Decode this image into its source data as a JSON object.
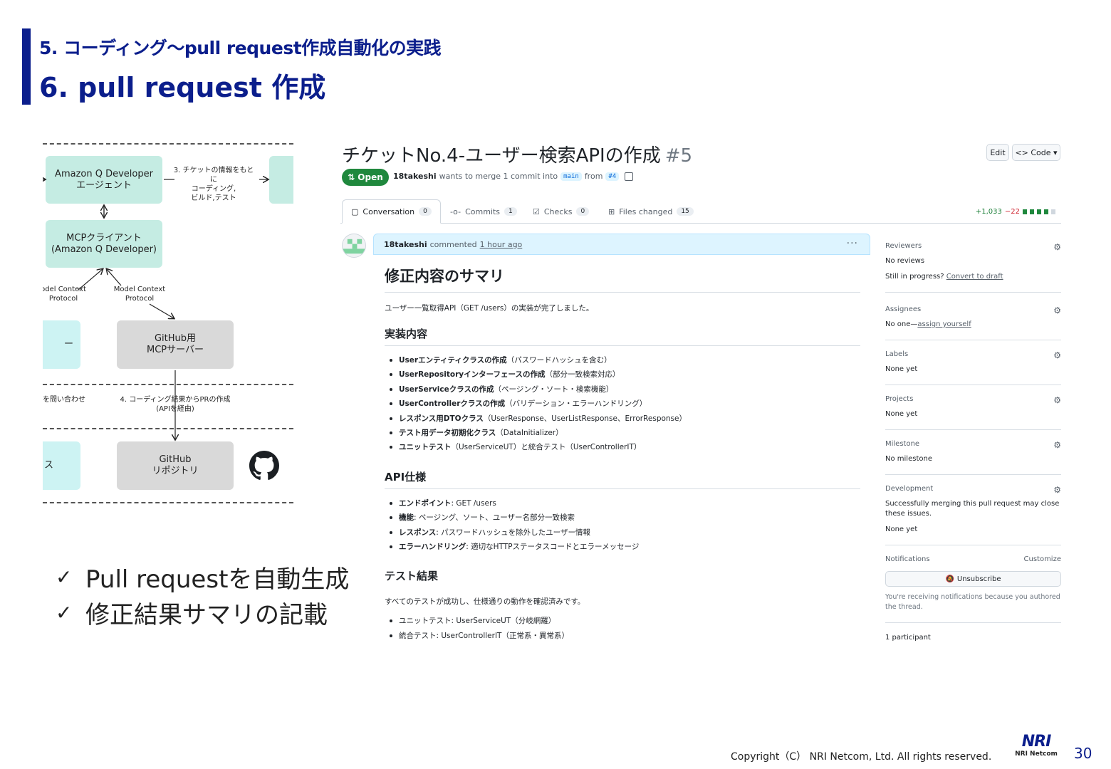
{
  "header": {
    "subtitle": "5. コーディング～pull request作成自動化の実践",
    "title": "6. pull request 作成"
  },
  "diagram": {
    "agent_box": "Amazon Q Developer\nエージェント",
    "mcp_client_box": "MCPクライアント\n(Amazon Q Developer)",
    "github_mcp_box": "GitHub用\nMCPサーバー",
    "github_repo_box": "GitHub\nリポジトリ",
    "left_box_top": "ー",
    "left_box_bottom": "ス",
    "label_step3": "3. チケットの情報をもとに\nコーディング,\nビルド,テスト",
    "label_protocol_left": "odel Context\nProtocol",
    "label_protocol_right": "Model Context\nProtocol",
    "label_query": "を問い合わせ",
    "label_step4": "4. コーディング結果からPRの作成\n(APIを経由)"
  },
  "bullets": [
    "Pull requestを自動生成",
    "修正結果サマリの記載"
  ],
  "github": {
    "pr_title": "チケットNo.4-ユーザー検索APIの作成",
    "pr_number": "#5",
    "edit_label": "Edit",
    "code_label": "<> Code ▾",
    "status": "Open",
    "author": "18takeshi",
    "meta_mid": "wants to merge 1 commit into",
    "base_branch": "main",
    "meta_from": "from",
    "head_branch": "#4",
    "tabs": [
      {
        "label": "Conversation",
        "count": "0"
      },
      {
        "label": "Commits",
        "count": "1"
      },
      {
        "label": "Checks",
        "count": "0"
      },
      {
        "label": "Files changed",
        "count": "15"
      }
    ],
    "additions": "+1,033",
    "deletions": "−22",
    "comment_author": "18takeshi",
    "comment_verb": "commented",
    "comment_time": "1 hour ago",
    "h_summary": "修正内容のサマリ",
    "summary_text": "ユーザー一覧取得API（GET /users）の実装が完了しました。",
    "h_impl": "実装内容",
    "impl_items": [
      {
        "bold": "Userエンティティクラスの作成",
        "rest": "（パスワードハッシュを含む）"
      },
      {
        "bold": "UserRepositoryインターフェースの作成",
        "rest": "（部分一致検索対応）"
      },
      {
        "bold": "UserServiceクラスの作成",
        "rest": "（ページング・ソート・検索機能）"
      },
      {
        "bold": "UserControllerクラスの作成",
        "rest": "（バリデーション・エラーハンドリング）"
      },
      {
        "bold": "レスポンス用DTOクラス",
        "rest": "（UserResponse、UserListResponse、ErrorResponse）"
      },
      {
        "bold": "テスト用データ初期化クラス",
        "rest": "（DataInitializer）"
      },
      {
        "bold": "ユニットテスト",
        "rest": "（UserServiceUT）と統合テスト（UserControllerIT）"
      }
    ],
    "h_api": "API仕様",
    "api_items": [
      {
        "bold": "エンドポイント",
        "rest": ": GET /users"
      },
      {
        "bold": "機能",
        "rest": ": ページング、ソート、ユーザー名部分一致検索"
      },
      {
        "bold": "レスポンス",
        "rest": ": パスワードハッシュを除外したユーザー情報"
      },
      {
        "bold": "エラーハンドリング",
        "rest": ": 適切なHTTPステータスコードとエラーメッセージ"
      }
    ],
    "h_test": "テスト結果",
    "test_text": "すべてのテストが成功し、仕様通りの動作を確認済みです。",
    "test_items": [
      "ユニットテスト: UserServiceUT（分岐網羅）",
      "統合テスト: UserControllerIT（正常系・異常系）"
    ],
    "sidebar": {
      "reviewers_label": "Reviewers",
      "reviewers_value": "No reviews",
      "reviewers_hint": "Still in progress?",
      "reviewers_link": "Convert to draft",
      "assignees_label": "Assignees",
      "assignees_value": "No one—",
      "assignees_link": "assign yourself",
      "labels_label": "Labels",
      "labels_value": "None yet",
      "projects_label": "Projects",
      "projects_value": "None yet",
      "milestone_label": "Milestone",
      "milestone_value": "No milestone",
      "development_label": "Development",
      "development_text": "Successfully merging this pull request may close these issues.",
      "development_value": "None yet",
      "notifications_label": "Notifications",
      "customize_label": "Customize",
      "unsubscribe_label": "Unsubscribe",
      "notification_reason": "You're receiving notifications because you authored the thread.",
      "participants": "1 participant"
    }
  },
  "footer": {
    "copyright": "Copyright（C） NRI Netcom, Ltd. All rights reserved.",
    "logo_big": "NRI",
    "logo_small": "NRI Netcom",
    "page": "30"
  }
}
